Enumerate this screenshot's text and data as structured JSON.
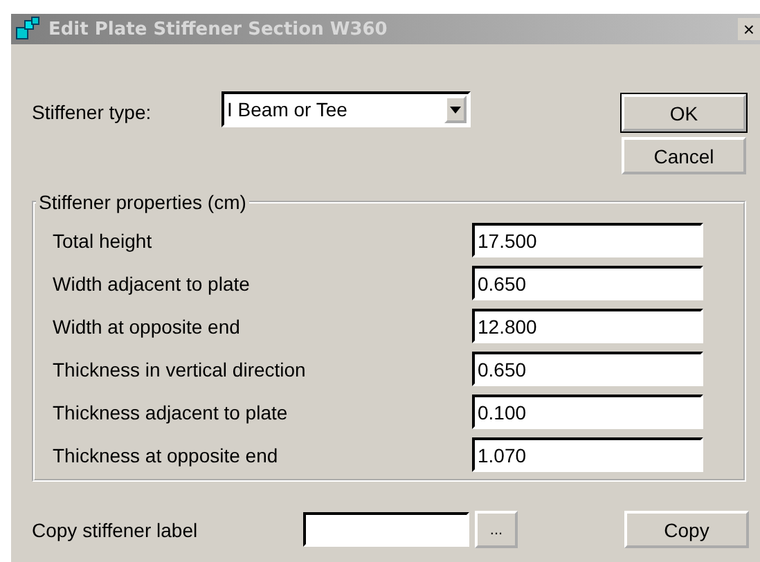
{
  "window": {
    "title": "Edit Plate Stiffener Section W360",
    "close": "×"
  },
  "stiffener_type": {
    "label": "Stiffener type:",
    "value": "I Beam or Tee"
  },
  "buttons": {
    "ok": "OK",
    "cancel": "Cancel"
  },
  "properties": {
    "title": "Stiffener properties (cm)",
    "rows": [
      {
        "label": "Total height",
        "value": "17.500"
      },
      {
        "label": "Width adjacent to plate",
        "value": "0.650"
      },
      {
        "label": "Width at opposite end",
        "value": "12.800"
      },
      {
        "label": "Thickness in vertical direction",
        "value": "0.650"
      },
      {
        "label": "Thickness adjacent to plate",
        "value": "0.100"
      },
      {
        "label": "Thickness at opposite end",
        "value": "1.070"
      }
    ]
  },
  "copy": {
    "label": "Copy stiffener label",
    "browse": "...",
    "button": "Copy"
  }
}
